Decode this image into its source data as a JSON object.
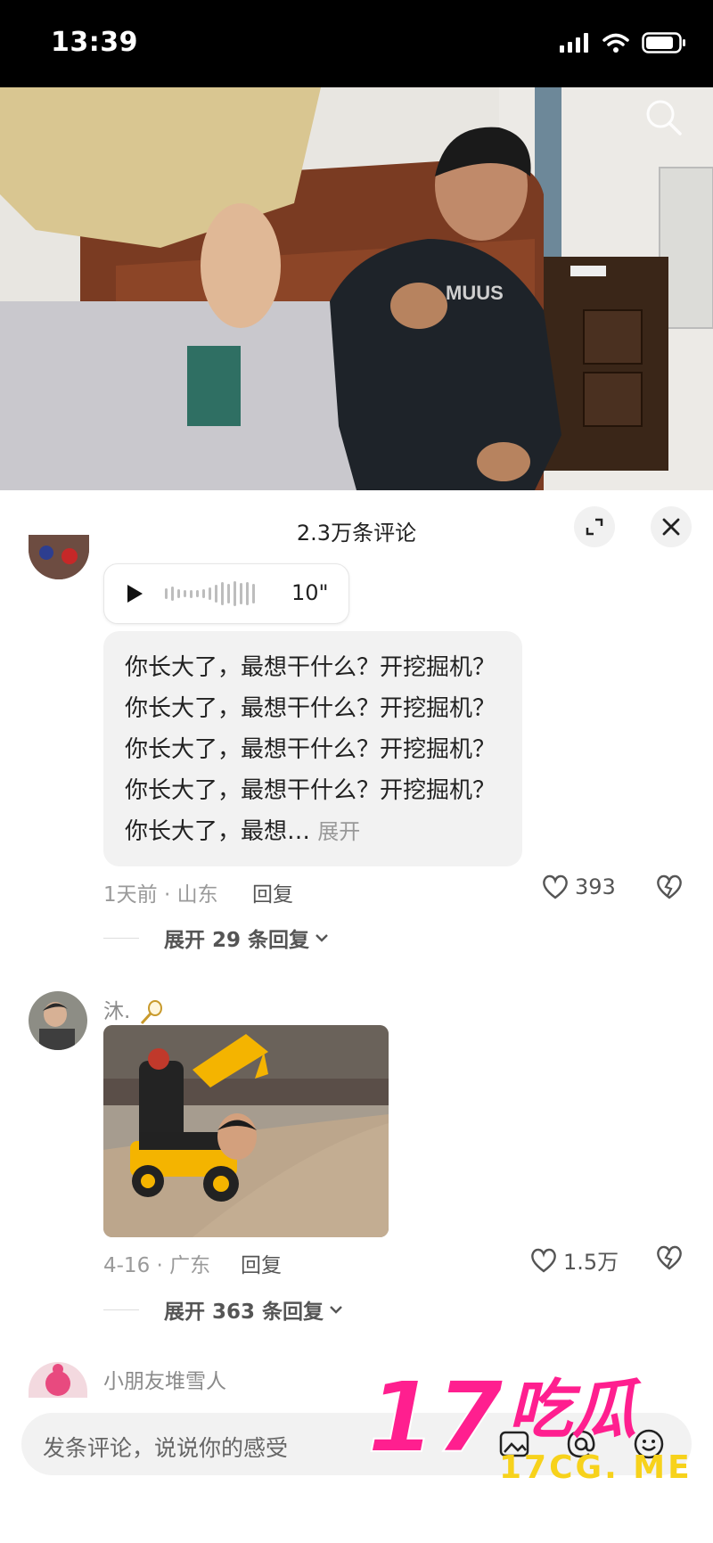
{
  "status_bar": {
    "time": "13:39"
  },
  "video": {
    "search_icon": "search-icon"
  },
  "comments_sheet": {
    "title": "2.3万条评论",
    "expand_icon": "expand-icon",
    "close_icon": "close-icon"
  },
  "comment1": {
    "voice_duration": "10\"",
    "text": "你长大了，最想干什么？开挖掘机？你长大了，最想干什么？开挖掘机？你长大了，最想干什么？开挖掘机？你长大了，最想干什么？开挖掘机？你长大了，最想…",
    "more_label": "展开",
    "meta": "1天前 · 山东",
    "reply_label": "回复",
    "likes": "393",
    "expand_replies": "展开 29 条回复"
  },
  "comment2": {
    "username": "沐.",
    "meta": "4-16 · 广东",
    "reply_label": "回复",
    "likes": "1.5万",
    "expand_replies": "展开 363 条回复"
  },
  "comment3": {
    "username": "小朋友堆雪人"
  },
  "input_bar": {
    "placeholder": "发条评论，说说你的感受"
  },
  "watermark": {
    "logo_text": "17吃瓜",
    "site_text": "17CG. ME"
  },
  "colors": {
    "watermark_pink": "#ff1f8f",
    "watermark_yellow": "#f7d21b"
  }
}
